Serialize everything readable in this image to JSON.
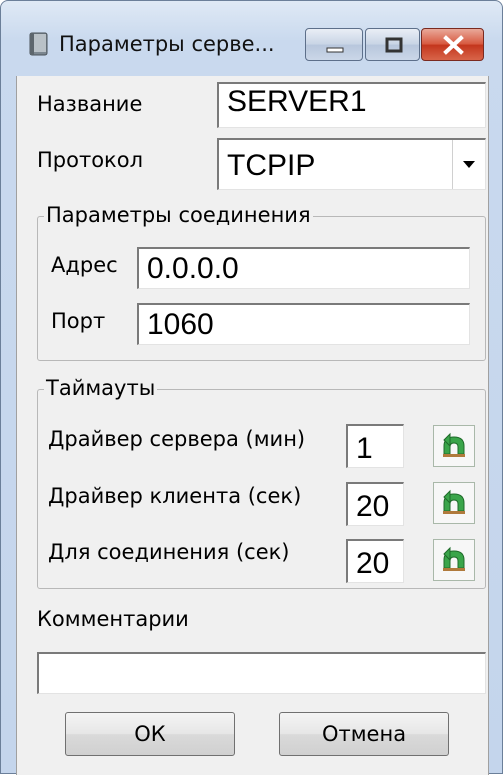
{
  "window": {
    "title": "Параметры серве..."
  },
  "form": {
    "name_label": "Название",
    "name_value": "SERVER1",
    "protocol_label": "Протокол",
    "protocol_value": "TCPIP"
  },
  "connection": {
    "legend": "Параметры соединения",
    "address_label": "Адрес",
    "address_value": "0.0.0.0",
    "port_label": "Порт",
    "port_value": "1060"
  },
  "timeouts": {
    "legend": "Таймауты",
    "rows": [
      {
        "label": "Драйвер сервера (мин)",
        "value": "1"
      },
      {
        "label": "Драйвер клиента (сек)",
        "value": "20"
      },
      {
        "label": "Для соединения (сек)",
        "value": "20"
      }
    ],
    "reset_icon": "green-undo-icon"
  },
  "comments": {
    "label": "Комментарии",
    "value": ""
  },
  "buttons": {
    "ok": "ОК",
    "cancel": "Отмена"
  },
  "colors": {
    "close_button": "#c3351c",
    "reset_icon": "#3aa54a"
  }
}
